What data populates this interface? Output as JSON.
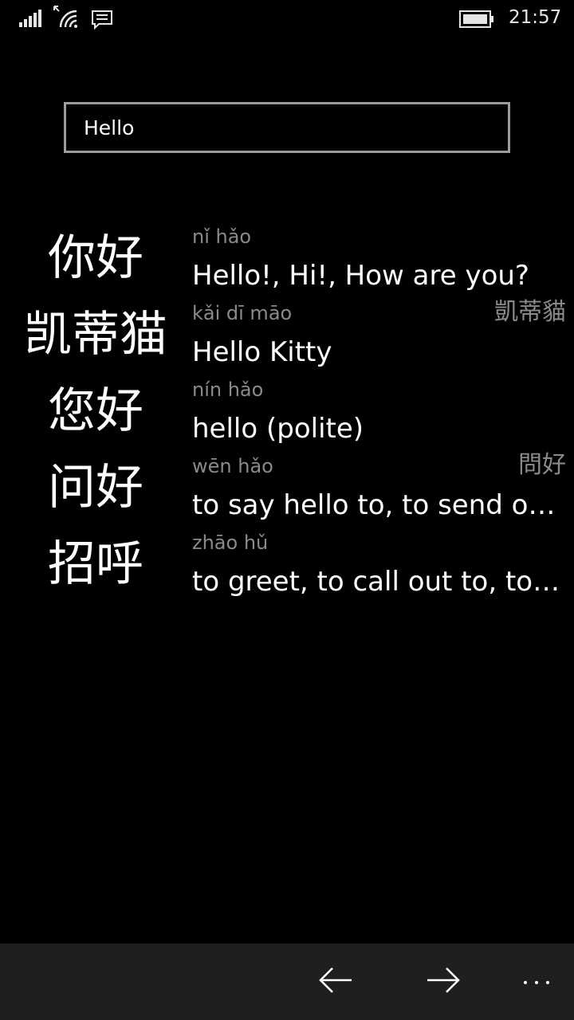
{
  "status_bar": {
    "time": "21:57",
    "icons": [
      "signal-strength-icon",
      "wifi-icon",
      "message-icon",
      "battery-icon"
    ]
  },
  "search": {
    "value": "Hello",
    "placeholder": ""
  },
  "results": [
    {
      "hanzi": "你好",
      "pinyin": "nǐ hǎo",
      "traditional": "",
      "meaning": "Hello!, Hi!, How are you?"
    },
    {
      "hanzi": "凯蒂猫",
      "pinyin": "kǎi dī māo",
      "traditional": "凱蒂貓",
      "meaning": "Hello Kitty"
    },
    {
      "hanzi": "您好",
      "pinyin": "nín hǎo",
      "traditional": "",
      "meaning": "hello (polite)"
    },
    {
      "hanzi": "问好",
      "pinyin": "wēn hǎo",
      "traditional": "問好",
      "meaning": "to say hello to, to send one's regards to"
    },
    {
      "hanzi": "招呼",
      "pinyin": "zhāo hǔ",
      "traditional": "",
      "meaning": "to greet, to call out to, to notify"
    }
  ],
  "app_bar": {
    "buttons": [
      "back-arrow-icon",
      "forward-arrow-icon",
      "more-icon"
    ]
  },
  "colors": {
    "background": "#000000",
    "text_primary": "#ffffff",
    "text_secondary": "#8a8a8a",
    "search_border": "#9c9c9c",
    "app_bar": "#1f1f1f"
  }
}
